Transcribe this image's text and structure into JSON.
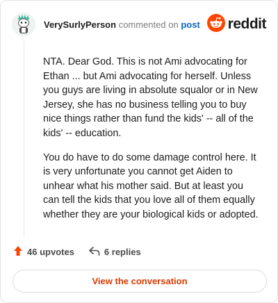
{
  "header": {
    "username": "VerySurlyPerson",
    "action": "commented on",
    "link_text": "post",
    "brand": "reddit",
    "avatar_icon": "snoo-avatar-icon",
    "brand_icon": "reddit-logo-icon"
  },
  "comment": {
    "paragraphs": [
      "NTA. Dear God. This is not Ami advocating for Ethan ... but Ami advocating for herself. Unless you guys are living in absolute squalor or in New Jersey, she has no business telling you to buy nice things rather than fund the kids' -- all of the kids' -- education.",
      "You do have to do some damage control here. It is very unfortunate you cannot get Aiden to unhear what his mother said. But at least you can tell the kids that you love all of them equally whether they are your biological kids or adopted."
    ]
  },
  "stats": {
    "upvotes": "46 upvotes",
    "replies": "6 replies"
  },
  "cta": {
    "label": "View the conversation"
  },
  "colors": {
    "brand": "#ff4500",
    "link": "#0a66c2",
    "cta_text": "#d93a00"
  }
}
